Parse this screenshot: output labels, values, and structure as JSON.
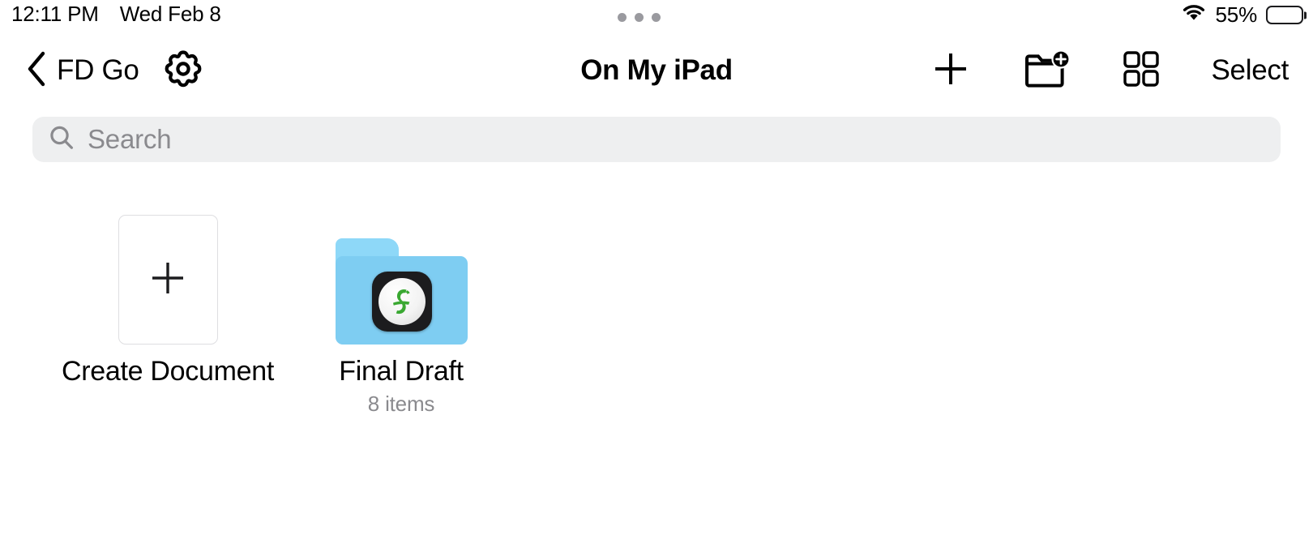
{
  "status_bar": {
    "time": "12:11 PM",
    "date": "Wed Feb 8",
    "battery_percent_label": "55%",
    "battery_level": 55,
    "wifi_icon": "wifi-icon",
    "multitask_handle_icon": "three-dots-icon"
  },
  "nav_bar": {
    "back_icon": "chevron-left-icon",
    "back_label": "FD Go",
    "settings_icon": "gear-icon",
    "title": "On My iPad",
    "add_icon": "plus-icon",
    "new_folder_icon": "folder-plus-icon",
    "grid_view_icon": "grid-view-icon",
    "select_label": "Select"
  },
  "search": {
    "icon": "search-icon",
    "placeholder": "Search",
    "value": ""
  },
  "content": {
    "items": [
      {
        "kind": "create",
        "label": "Create Document",
        "subtitle": "",
        "icon": "plus-icon"
      },
      {
        "kind": "folder",
        "label": "Final Draft",
        "subtitle": "8 items",
        "icon": "folder-icon",
        "badge_icon": "final-draft-app-icon"
      }
    ]
  },
  "colors": {
    "folder_body": "#7ecdf2",
    "folder_tab": "#8ed8f8",
    "badge_background": "#1c1c1e",
    "brand_green": "#3aa832",
    "search_background": "#eeeff0",
    "secondary_text": "#8a8a8e"
  }
}
